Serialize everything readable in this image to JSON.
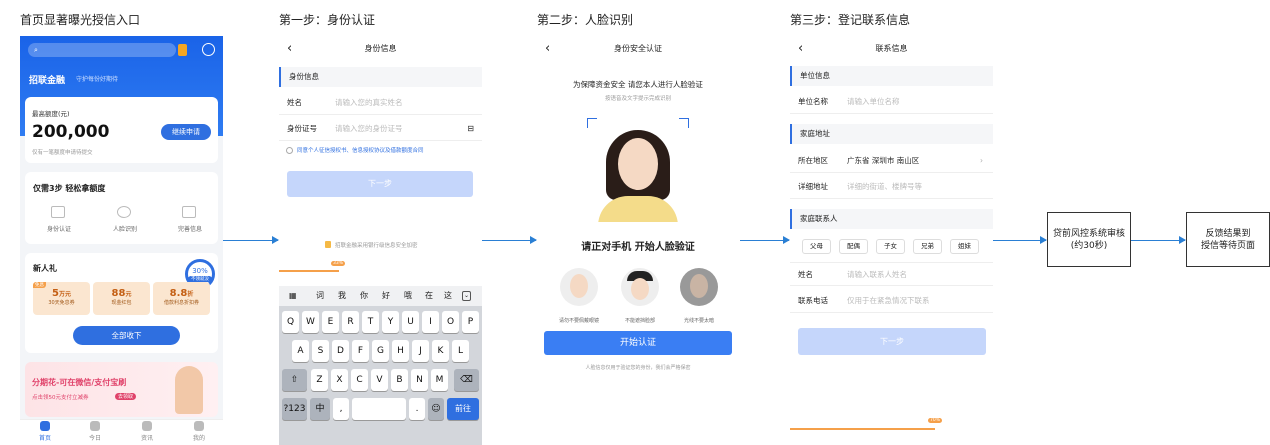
{
  "captions": [
    "首页显著曝光授信入口",
    "第一步：身份认证",
    "第二步：人脸识别",
    "第三步：登记联系信息"
  ],
  "s1": {
    "brand": "招联金融",
    "slogan": "守护每份好期待",
    "limit_label": "最高额度(元)",
    "limit_value": "200,000",
    "limit_note": "仅有一笔额度申请待提交",
    "continue_btn": "继续申请",
    "steps_title": "仅需3步 轻松拿额度",
    "steps": [
      "身份认证",
      "人脸识别",
      "完善信息"
    ],
    "gift_title": "新人礼",
    "gift_badge": "30%",
    "gift_badge_sub": "不领就没",
    "coupons": [
      {
        "value": "5",
        "unit": "万元",
        "desc": "30天免息券",
        "tag": "免息"
      },
      {
        "value": "88",
        "unit": "元",
        "desc": "现金红包",
        "tag": ""
      },
      {
        "value": "8.8",
        "unit": "折",
        "desc": "借款利息折扣券",
        "tag": ""
      }
    ],
    "collect_btn": "全部收下",
    "banner_title": "分期花-可在微信/支付宝刷",
    "banner_sub": "点击领50元支付立减券",
    "banner_tag": "去领取",
    "tabs": [
      "首页",
      "今日",
      "资讯",
      "我的"
    ]
  },
  "s2": {
    "title": "身份信息",
    "section": "身份信息",
    "name_label": "姓名",
    "name_ph": "请输入您的真实姓名",
    "id_label": "身份证号",
    "id_ph": "请输入您的身份证号",
    "agree": "同意个人征信授权书、信息授权协议及借款额度合同",
    "next": "下一步",
    "safe": "招联金融采用银行级信息安全加密",
    "progress": "33%",
    "cand": [
      "词",
      "我",
      "你",
      "好",
      "哦",
      "在",
      "这"
    ],
    "row1": [
      "Q",
      "W",
      "E",
      "R",
      "T",
      "Y",
      "U",
      "I",
      "O",
      "P"
    ],
    "row2": [
      "A",
      "S",
      "D",
      "F",
      "G",
      "H",
      "J",
      "K",
      "L"
    ],
    "row3": [
      "Z",
      "X",
      "C",
      "V",
      "B",
      "N",
      "M"
    ],
    "k123": "?123",
    "kzh": "中",
    "kcomma": ",",
    "kdot": ".",
    "kgo": "前往"
  },
  "s3": {
    "title": "身份安全认证",
    "headline": "为保障资金安全 请您本人进行人脸验证",
    "sub": "按语音及文字提示完成识别",
    "prompt": "请正对手机 开始人脸验证",
    "tips": [
      "请勿不要佩戴眼镜",
      "不能遮挡脸部",
      "光线不要太暗"
    ],
    "start": "开始认证",
    "foot": "人脸信息仅用于验证您的身份，我们会严格保密"
  },
  "s4": {
    "title": "联系信息",
    "sec1": "单位信息",
    "unit_label": "单位名称",
    "unit_ph": "请输入单位名称",
    "sec2": "家庭地址",
    "area_label": "所在地区",
    "area_val": "广东省 深圳市 南山区",
    "addr_label": "详细地址",
    "addr_ph": "详细的街道、楼牌号等",
    "sec3": "家庭联系人",
    "rel": [
      "父母",
      "配偶",
      "子女",
      "兄弟",
      "姐妹"
    ],
    "cname_label": "姓名",
    "cname_ph": "请输入联系人姓名",
    "phone_label": "联系电话",
    "phone_ph": "仅用于在紧急情况下联系",
    "next": "下一步",
    "progress": "70%"
  },
  "box1": [
    "贷前风控系统审核",
    "(约30秒)"
  ],
  "box2": [
    "反馈结果到",
    "授信等待页面"
  ]
}
